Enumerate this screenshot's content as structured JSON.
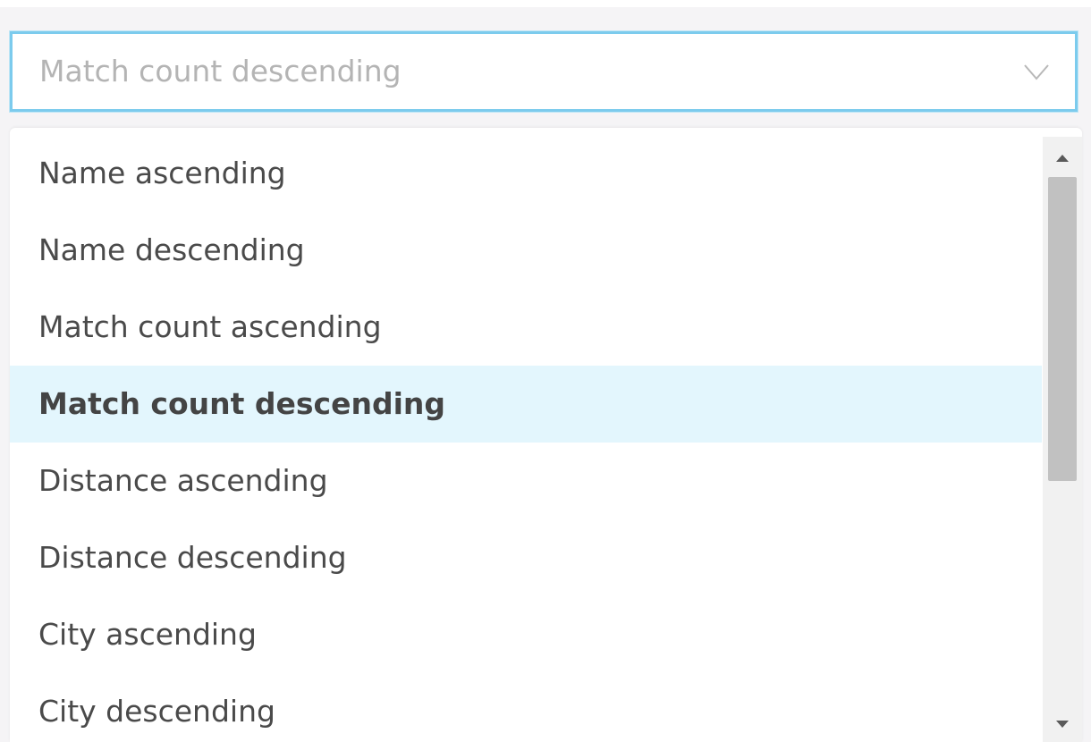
{
  "select": {
    "value": "Match count descending"
  },
  "dropdown": {
    "options": [
      {
        "label": "Name ascending",
        "selected": false
      },
      {
        "label": "Name descending",
        "selected": false
      },
      {
        "label": "Match count ascending",
        "selected": false
      },
      {
        "label": "Match count descending",
        "selected": true
      },
      {
        "label": "Distance ascending",
        "selected": false
      },
      {
        "label": "Distance descending",
        "selected": false
      },
      {
        "label": "City ascending",
        "selected": false
      },
      {
        "label": "City descending",
        "selected": false
      }
    ]
  },
  "colors": {
    "focus_border": "#7ccbed",
    "selected_bg": "#e3f6fd",
    "text": "#4a4a4a",
    "placeholder_text": "#b4b4b4",
    "scroll_track": "#f1f1f1",
    "scroll_thumb": "#c1c1c1"
  },
  "icons": {
    "select_indicator": "chevron-down-icon",
    "scroll_up": "scroll-up-arrow-icon",
    "scroll_down": "scroll-down-arrow-icon"
  }
}
